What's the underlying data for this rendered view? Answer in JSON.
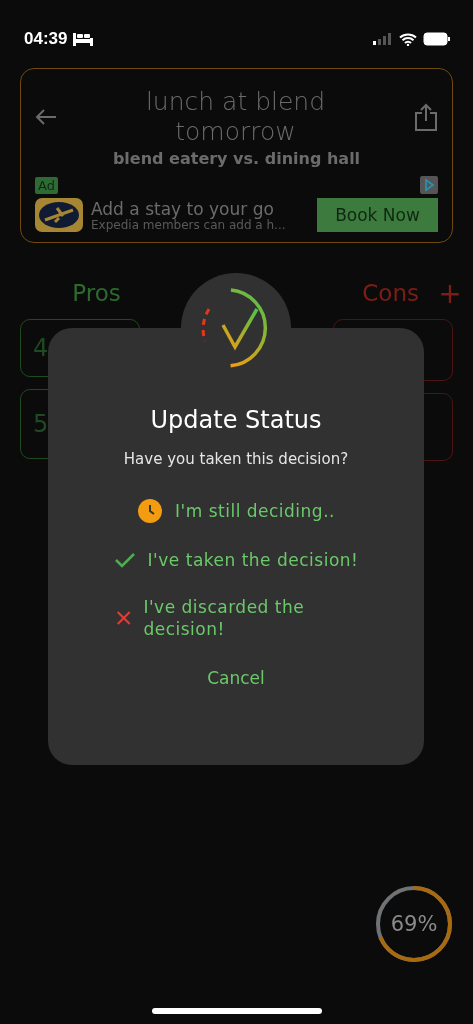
{
  "status_bar": {
    "time": "04:39"
  },
  "header": {
    "title": "lunch at blend tomorrow",
    "subtitle": "blend eatery vs. dining hall"
  },
  "ad": {
    "badge": "Ad",
    "headline": "Add a stay to your go",
    "body": "Expedia members can add a h...",
    "cta": "Book Now"
  },
  "columns": {
    "pros": "Pros",
    "cons": "Cons",
    "add": "+"
  },
  "pros_cards": [
    {
      "label": "4"
    },
    {
      "label": "5"
    }
  ],
  "cons_cards": [
    {
      "kind": "card"
    },
    {
      "kind": "card"
    }
  ],
  "dialog": {
    "title": "Update Status",
    "message": "Have you taken this decision?",
    "options": [
      {
        "kind": "clock",
        "label": "I'm still deciding.."
      },
      {
        "kind": "check",
        "label": "I've taken the decision!"
      },
      {
        "kind": "cross",
        "label": "I've discarded the decision!"
      }
    ],
    "cancel": "Cancel"
  },
  "progress": {
    "level": 0.69,
    "reading": "69%"
  }
}
